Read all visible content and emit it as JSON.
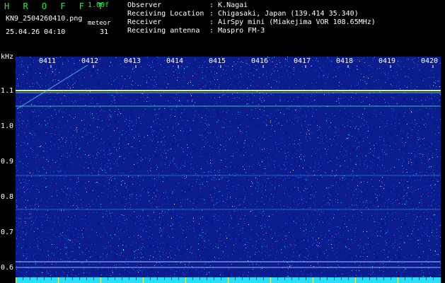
{
  "header": {
    "title": "H R O F F T",
    "version": "1.00f",
    "filename": "KN9_2504260410.png",
    "meteor_label": "meteor",
    "datetime": "25.04.26 04:10",
    "meteor_count": "31"
  },
  "info": [
    {
      "label": "Observer",
      "value": ": K.Nagai"
    },
    {
      "label": "Receiving Location",
      "value": ": Chigasaki, Japan (139.414 35.340)"
    },
    {
      "label": "Receiver",
      "value": ": AirSpy mini (Miakejima VOR 108.65MHz)"
    },
    {
      "label": "Receiving antenna",
      "value": ": Maspro FM-3"
    }
  ],
  "axis": {
    "y_unit": "kHz",
    "y_ticks": [
      "1.1",
      "1.0",
      "0.9",
      "0.8",
      "0.7",
      "0.6"
    ],
    "x_ticks": [
      "0411",
      "0412",
      "0413",
      "0414",
      "0415",
      "0416",
      "0417",
      "0418",
      "0419",
      "0420"
    ]
  },
  "colors": {
    "background": "#0b1c8e",
    "noise_bright": "#35e0ff",
    "carrier": "#f4ff6a",
    "header_green": "#2ee64a"
  }
}
